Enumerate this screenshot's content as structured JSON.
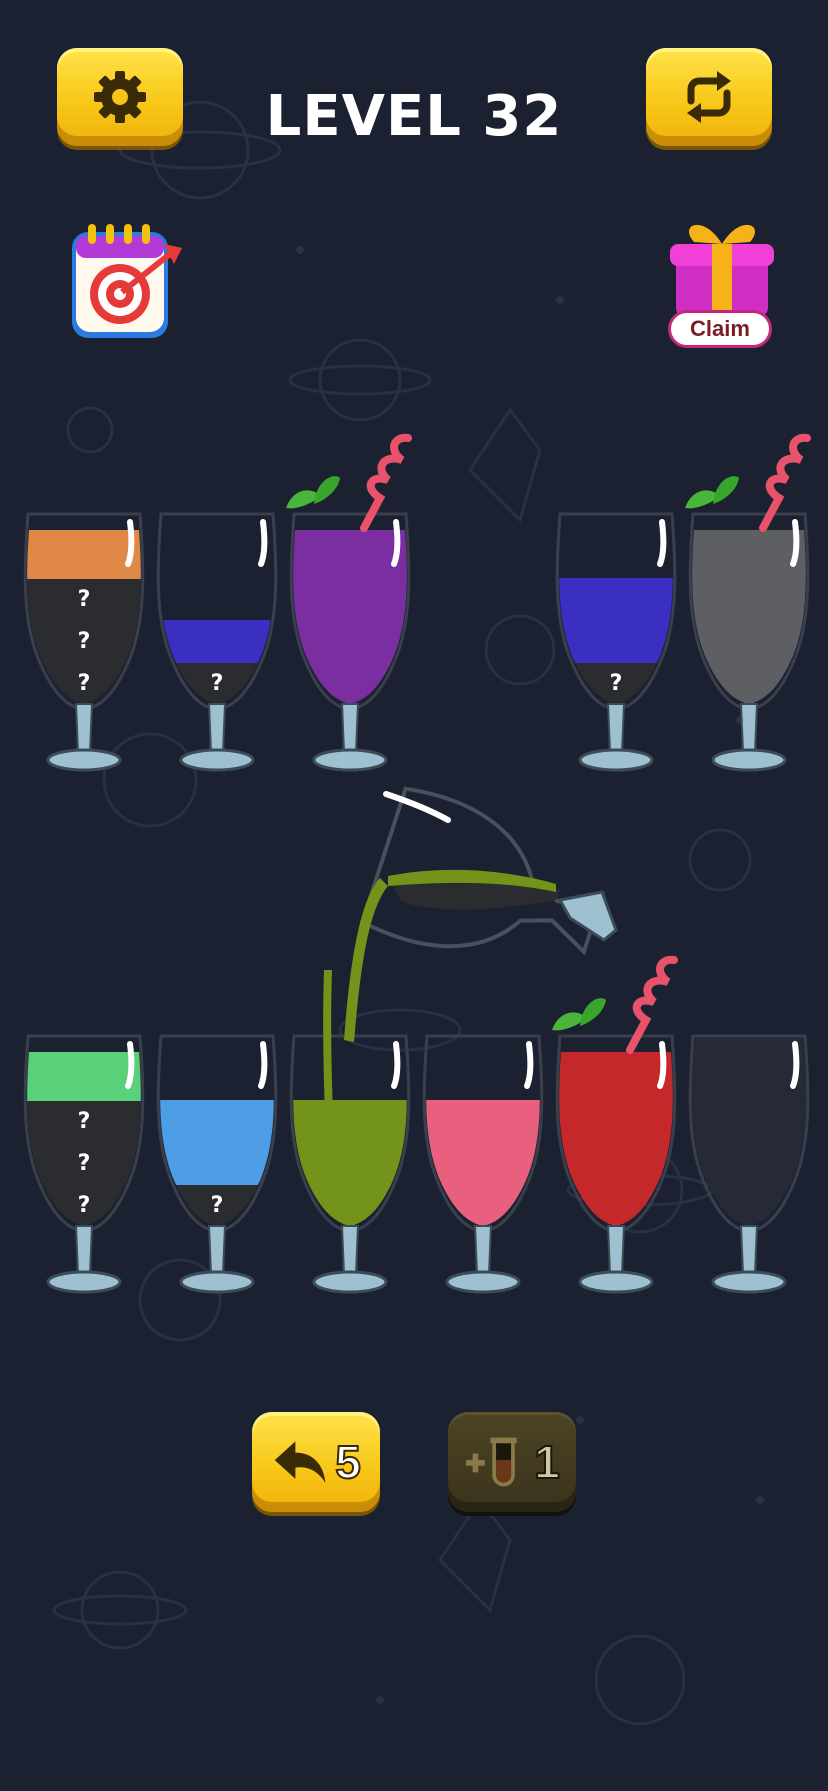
{
  "header": {
    "level_title": "LEVEL 32",
    "settings_icon": "gear-icon",
    "restart_icon": "refresh-arrows-icon"
  },
  "side": {
    "daily_goal_icon": "calendar-target-icon",
    "gift_icon": "gift-box-icon",
    "claim_label": "Claim"
  },
  "colors": {
    "background": "#1b2131",
    "button_yellow": "#f7c515",
    "empty_liquid": "#2b2c30",
    "orange": "#e08848",
    "blue": "#3a2fc0",
    "purple": "#7a2ea0",
    "gray": "#5d5f63",
    "green_light": "#5ad07a",
    "sky_blue": "#4e9ee6",
    "olive_green": "#74931a",
    "pink": "#e95f7e",
    "red": "#c5282a"
  },
  "rows": [
    {
      "glasses": [
        {
          "id": 1,
          "layers_bottom_to_top": [
            "hidden",
            "hidden",
            "hidden",
            "orange"
          ],
          "unknown_marks": [
            "?",
            "?",
            "?"
          ]
        },
        {
          "id": 2,
          "layers_bottom_to_top": [
            "hidden",
            "blue"
          ],
          "unknown_marks": [
            "?"
          ]
        },
        {
          "id": 3,
          "layers_bottom_to_top": [
            "purple",
            "purple",
            "purple",
            "purple"
          ],
          "unknown_marks": [],
          "completed": true
        },
        {
          "id": 4,
          "layers_bottom_to_top": [
            "hidden",
            "blue",
            "blue"
          ],
          "unknown_marks": [
            "?"
          ]
        },
        {
          "id": 5,
          "layers_bottom_to_top": [
            "gray",
            "gray",
            "gray",
            "gray"
          ],
          "unknown_marks": [],
          "completed": true
        }
      ]
    },
    {
      "glasses": [
        {
          "id": 6,
          "layers_bottom_to_top": [
            "hidden",
            "hidden",
            "hidden",
            "green_light"
          ],
          "unknown_marks": [
            "?",
            "?",
            "?"
          ]
        },
        {
          "id": 7,
          "layers_bottom_to_top": [
            "hidden",
            "sky_blue",
            "sky_blue"
          ],
          "unknown_marks": [
            "?"
          ]
        },
        {
          "id": 8,
          "layers_bottom_to_top": [
            "olive_green",
            "olive_green",
            "olive_green"
          ],
          "unknown_marks": [],
          "receiving_pour": true
        },
        {
          "id": 9,
          "layers_bottom_to_top": [
            "pink",
            "pink",
            "pink"
          ],
          "unknown_marks": []
        },
        {
          "id": 10,
          "layers_bottom_to_top": [
            "red",
            "red",
            "red",
            "red"
          ],
          "unknown_marks": [],
          "completed": true
        },
        {
          "id": 11,
          "layers_bottom_to_top": [],
          "unknown_marks": []
        }
      ]
    }
  ],
  "pouring_glass": {
    "layers": [
      "olive_green",
      "hidden"
    ]
  },
  "bottom": {
    "undo_icon": "undo-arrow-icon",
    "undo_count": "5",
    "add_tube_icon": "add-tube-icon",
    "add_tube_count": "1"
  }
}
